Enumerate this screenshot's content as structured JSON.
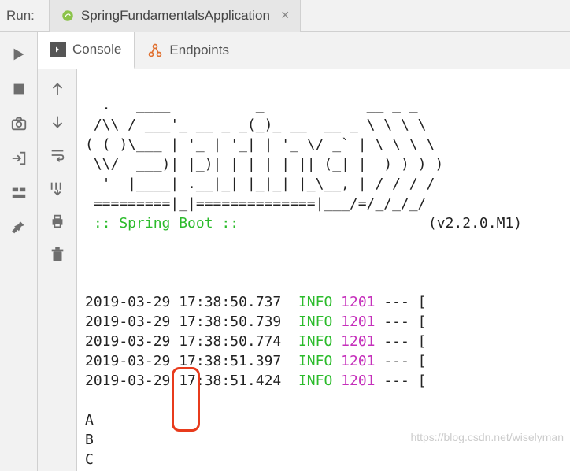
{
  "top": {
    "run_label": "Run:",
    "config_name": "SpringFundamentalsApplication",
    "close": "×"
  },
  "tabs": {
    "console": "Console",
    "endpoints": "Endpoints"
  },
  "ascii_art": "  .   ____          _            __ _ _\n /\\\\ / ___'_ __ _ _(_)_ __  __ _ \\ \\ \\ \\\n( ( )\\___ | '_ | '_| | '_ \\/ _` | \\ \\ \\ \\\n \\\\/  ___)| |_)| | | | | || (_| |  ) ) ) )\n  '  |____| .__|_| |_|_| |_\\__, | / / / /\n =========|_|==============|___/=/_/_/_/",
  "boot": {
    "label": " :: Spring Boot :: ",
    "version": "(v2.2.0.M1)"
  },
  "logs": [
    {
      "ts": "2019-03-29 17:38:50.737",
      "level": "INFO",
      "pid": "1201",
      "tail": " --- ["
    },
    {
      "ts": "2019-03-29 17:38:50.739",
      "level": "INFO",
      "pid": "1201",
      "tail": " --- ["
    },
    {
      "ts": "2019-03-29 17:38:50.774",
      "level": "INFO",
      "pid": "1201",
      "tail": " --- ["
    },
    {
      "ts": "2019-03-29 17:38:51.397",
      "level": "INFO",
      "pid": "1201",
      "tail": " --- ["
    },
    {
      "ts": "2019-03-29 17:38:51.424",
      "level": "INFO",
      "pid": "1201",
      "tail": " --- ["
    }
  ],
  "output_lines": [
    "A",
    "B",
    "C"
  ],
  "watermark": "https://blog.csdn.net/wiselyman"
}
